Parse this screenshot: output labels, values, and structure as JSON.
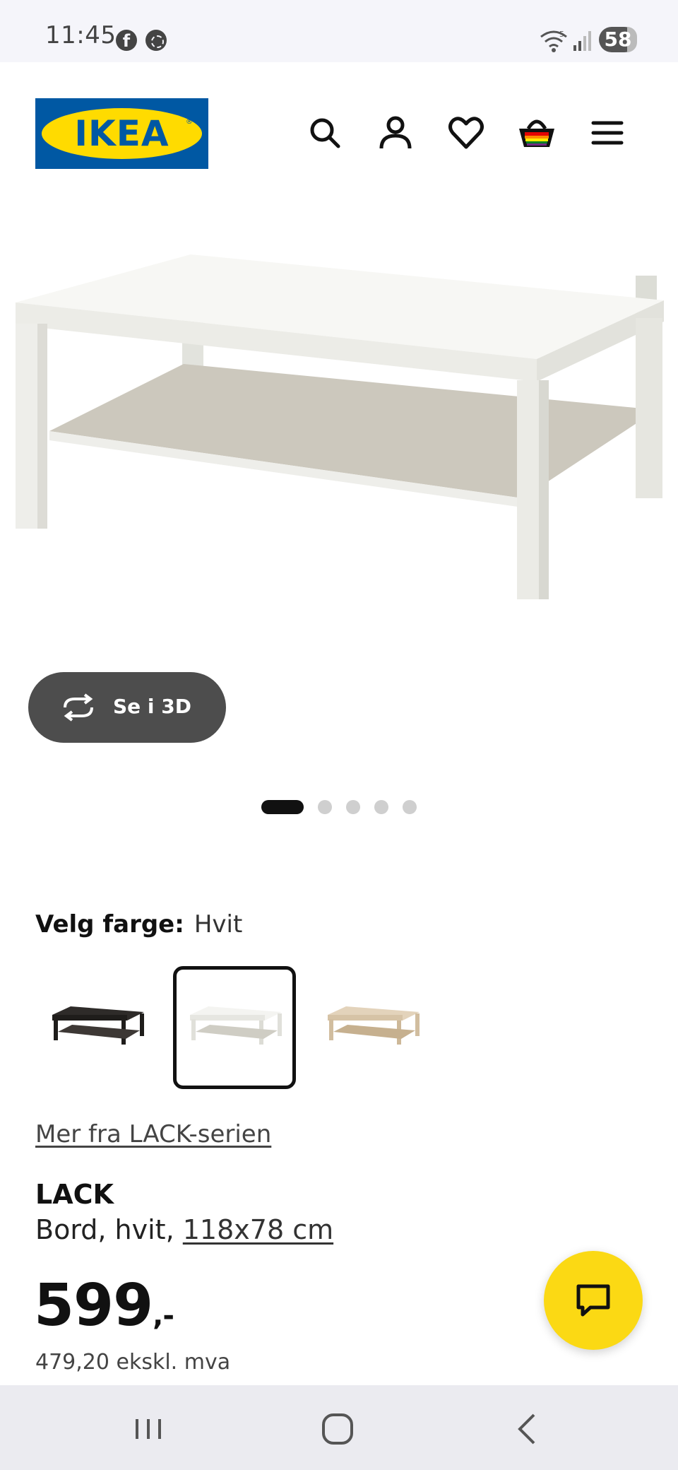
{
  "status_bar": {
    "time": "11:45",
    "battery": "58",
    "wifi_badge": "5"
  },
  "header": {
    "logo_text": "IKEA",
    "logo_reg": "®",
    "icons": [
      "search-icon",
      "account-icon",
      "heart-icon",
      "basket-icon",
      "menu-icon"
    ]
  },
  "gallery": {
    "view_3d_label": "Se i 3D",
    "slide_count": 5,
    "active_slide": 1
  },
  "color_select": {
    "label": "Velg farge:",
    "value": "Hvit",
    "options": [
      "Svartbrun",
      "Hvit",
      "Hvitlasert eikemønstret"
    ],
    "selected_index": 1
  },
  "product": {
    "series_link": "Mer fra LACK-serien",
    "name": "LACK",
    "description": "Bord, hvit, ",
    "size": "118x78 cm",
    "price": "599",
    "price_suffix": ",-",
    "price_ex_vat": "479,20 ekskl. mva"
  },
  "colors": {
    "ikea_blue": "#0058a3",
    "ikea_yellow": "#ffdb00",
    "fab_yellow": "#fbd914",
    "button_dark": "#4d4d4d"
  }
}
